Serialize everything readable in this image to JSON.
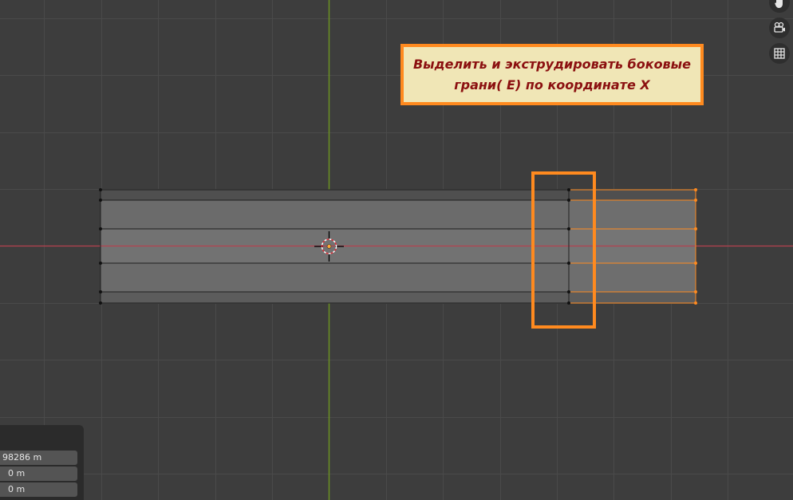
{
  "viewport": {
    "background": "#3d3d3d",
    "grid_color": "#4a4a4a",
    "x_axis_color": "#b5414f",
    "y_axis_color": "#6b8f23"
  },
  "annotation": {
    "line1": "Выделить и экструдировать боковые",
    "line2": "грани( E) по координате X",
    "border_color": "#ff8a1f",
    "background": "#f0e6b6",
    "text_color": "#8b1010"
  },
  "gizmo": {
    "icons": [
      "hand-pan-icon",
      "camera-icon",
      "grid-icon"
    ]
  },
  "operator_panel": {
    "fields": [
      "98286 m",
      "0 m",
      "0 m"
    ]
  },
  "mesh": {
    "face_color": "#6b6b6b",
    "edge_color": "#1f1f1f",
    "selected_color": "#ff8a1f"
  }
}
